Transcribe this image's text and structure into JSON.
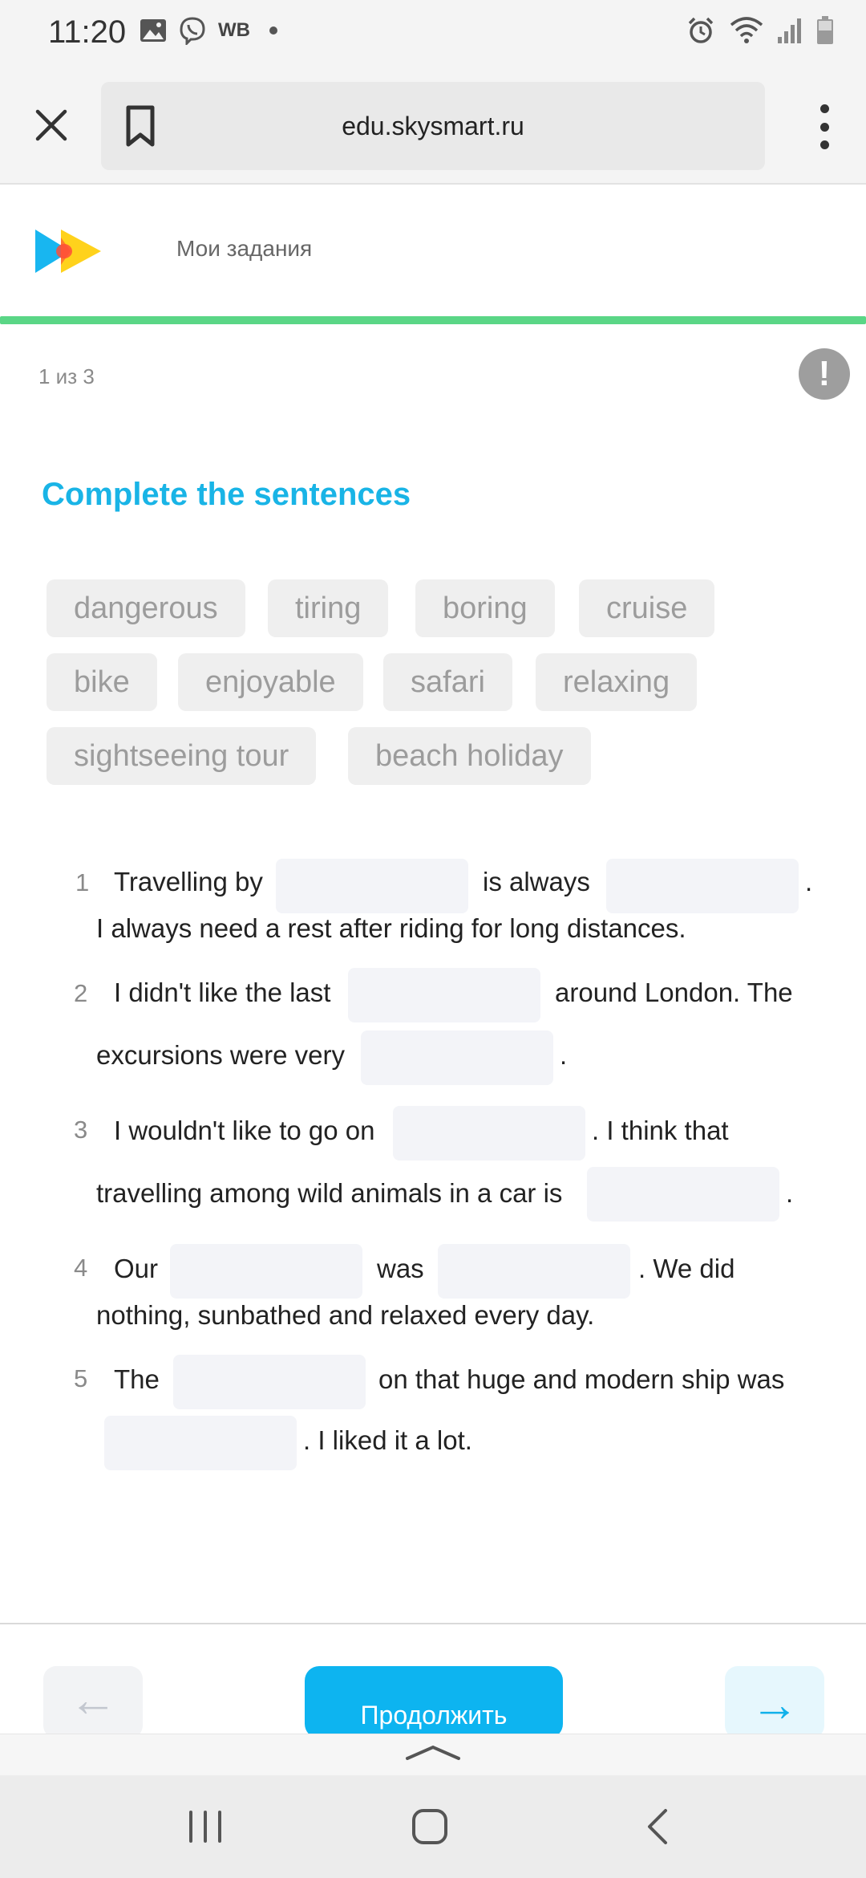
{
  "status_bar": {
    "time": "11:20",
    "carrier_text": "WB",
    "icons_left": [
      "image-icon",
      "viber-icon"
    ],
    "icons_right": [
      "alarm-icon",
      "wifi-icon",
      "signal-icon",
      "battery-icon"
    ]
  },
  "browser": {
    "url": "edu.skysmart.ru",
    "close_icon": "close-icon",
    "bookmark_icon": "bookmark-icon",
    "menu_icon": "more-vertical-icon"
  },
  "site": {
    "nav_link": "Мои задания",
    "progress_fraction": 1.0,
    "progress_color": "#5ad686"
  },
  "task": {
    "counter": "1 из 3",
    "report_icon": "!",
    "title": "Complete the sentences",
    "title_color": "#19b4e6",
    "word_bank": [
      "dangerous",
      "tiring",
      "boring",
      "cruise",
      "bike",
      "enjoyable",
      "safari",
      "relaxing",
      "sightseeing tour",
      "beach holiday"
    ],
    "sentences": [
      {
        "num": "1",
        "parts": [
          "Travelling by",
          "is always",
          ".",
          "I always need a rest after riding for long distances."
        ]
      },
      {
        "num": "2",
        "parts": [
          "I didn't like the last",
          "around London. The",
          "excursions were very",
          "."
        ]
      },
      {
        "num": "3",
        "parts": [
          "I wouldn't like to go on",
          ". I think that",
          "travelling among wild animals in a car is",
          "."
        ]
      },
      {
        "num": "4",
        "parts": [
          "Our",
          "was",
          ". We did",
          "nothing, sunbathed and relaxed every day."
        ]
      },
      {
        "num": "5",
        "parts": [
          "The",
          "on that huge and modern ship was",
          ". I liked it a lot."
        ]
      }
    ]
  },
  "footer": {
    "prev_label": "←",
    "continue_label": "Продолжить",
    "next_label": "→"
  }
}
